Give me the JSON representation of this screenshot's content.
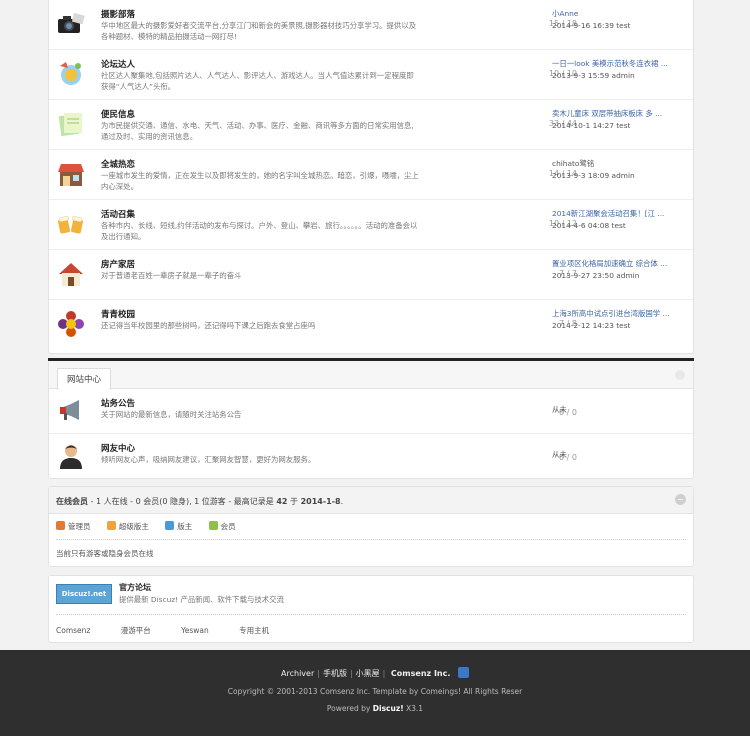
{
  "forums": [
    {
      "name": "摄影部落",
      "desc": "华中地区最大的摄影爱好者交流平台,分享江门和新会的美景照,摄影器材技巧分享学习。提供以及各种题材、模特的精品拍摄活动一网打尽!",
      "count": "15 / 18",
      "last_title": "小Anne",
      "last_meta": "2014-9-16 16:39 test",
      "icon": "camera-icon"
    },
    {
      "name": "论坛达人",
      "desc": "社区达人聚集地,包括照片达人、人气达人、影评达人、游戏达人。当人气值达累计到一定程度即获得“人气达人”头衔。",
      "count": "10 / 10",
      "last_title": "一日一look 美模示范秋冬连衣裙 ...",
      "last_meta": "2013-9-3 15:59 admin",
      "icon": "award-icon"
    },
    {
      "name": "便民信息",
      "desc": "为市民提供交通、通信、水电、天气、活动、办事、医疗、金融、商讯等多方面的日常实用信息,通过及时、实用的资讯信息。",
      "count": "33 / 44",
      "last_title": "卖木儿童床 双层带抽床板床 多 ...",
      "last_meta": "2014-10-1 14:27 test",
      "icon": "notes-icon"
    },
    {
      "name": "全城热恋",
      "desc": "一座城市发生的爱情，正在发生以及即将发生的，她的名字叫全城热恋。暗恋，引爆，嗫嚅，尘上内心深处。",
      "count": "14 / 14",
      "last_title": "chihato鹭铭",
      "last_meta": "2013-9-3 18:09 admin",
      "icon": "shop-icon"
    },
    {
      "name": "活动召集",
      "desc": "各种市内、长线、短线,约伴活动的发布与探讨。户外、登山、攀岩、旅行。。。。。。活动的准备会以及出行通知。",
      "count": "10 / 12",
      "last_title": "2014新江湖聚会活动召集！[江 ...",
      "last_meta": "2014-4-6 04:08 test",
      "icon": "cheers-icon"
    },
    {
      "name": "房产家居",
      "desc": "对于普通老百姓一辈房子就是一辈子的奋斗",
      "count": "7 / 7",
      "last_title": "置业项区化格局加速确立 综合体 ...",
      "last_meta": "2013-9-27 23:50 admin",
      "icon": "house-icon"
    },
    {
      "name": "青青校园",
      "desc": "还记得当年校园里的那些树吗，还记得吗下课之后跑去食堂占座吗",
      "count": "7 / 8",
      "last_title": "上海3所高中试点引进台湾版国学 ...",
      "last_meta": "2014-2-12 14:23 test",
      "icon": "flower-icon"
    }
  ],
  "site_center": {
    "tab": "网站中心",
    "forums": [
      {
        "name": "站务公告",
        "desc": "关于网站的最新信息，请随时关注站务公告",
        "count": "0 / 0",
        "last_title": "从未",
        "icon": "megaphone-icon"
      },
      {
        "name": "网友中心",
        "desc": "倾听网友心声，吸纳网友建议，汇聚网友智慧，更好为网友服务。",
        "count": "0 / 0",
        "last_title": "从未",
        "icon": "user-icon"
      }
    ]
  },
  "online": {
    "label": "在线会员",
    "summary_mid": "- 1 人在线 - 0 会员(0 隐身), 1 位游客 - 最高记录是",
    "record": "42",
    "record_mid": "于",
    "record_date": "2014-1-8",
    "legend": [
      {
        "label": "管理员",
        "color": "#e07a34"
      },
      {
        "label": "超级版主",
        "color": "#f0a33c"
      },
      {
        "label": "版主",
        "color": "#4a9ad8"
      },
      {
        "label": "会员",
        "color": "#8cc24a"
      }
    ],
    "note": "当前只有游客或隐身会员在线"
  },
  "links": {
    "logo_text": "Discuz!.net",
    "title": "官方论坛",
    "desc": "提供最新 Discuz! 产品新闻、软件下载与技术交流",
    "items": [
      "Comsenz",
      "漫游平台",
      "Yeswan",
      "专用主机"
    ]
  },
  "footer": {
    "nav": [
      "Archiver",
      "手机版",
      "小黑屋"
    ],
    "brand": "Comsenz Inc.",
    "copyright": "Copyright © 2001-2013 Comsenz Inc.  Template by Comeings! All Rights Reser",
    "powered_prefix": "Powered by",
    "powered_name": "Discuz!",
    "powered_version": "X3.1"
  }
}
